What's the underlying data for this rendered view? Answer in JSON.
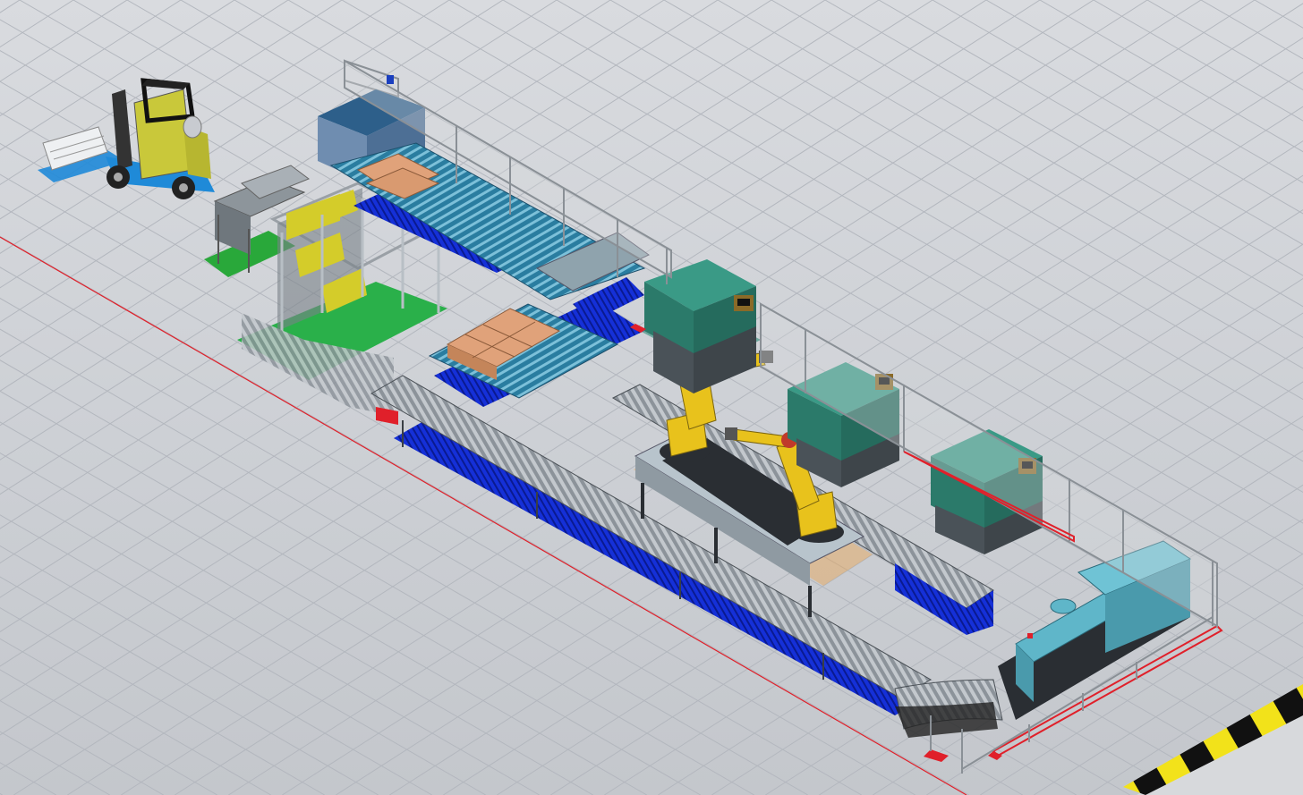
{
  "viewport": {
    "background": "#cdd0d5",
    "grid_color": "#b3b7be",
    "axis_color": "#e0202a"
  },
  "scene": {
    "objects": [
      {
        "name": "forklift",
        "kind": "vehicle",
        "color": "#c9c83a"
      },
      {
        "name": "pallet-feeder",
        "kind": "machine",
        "color": "#3d7f9a"
      },
      {
        "name": "pallet-dispenser",
        "kind": "machine",
        "color": "#2d5f8a"
      },
      {
        "name": "pallet-conveyor-upper",
        "kind": "conveyor",
        "color": "#3e8ca5"
      },
      {
        "name": "pallet-conveyor-lower",
        "kind": "conveyor",
        "color": "#3e8ca5"
      },
      {
        "name": "packaging-station",
        "kind": "machine",
        "color": "#d4cc2a"
      },
      {
        "name": "main-roller-conveyor",
        "kind": "conveyor",
        "color": "#9aa0a6"
      },
      {
        "name": "curved-conveyor",
        "kind": "conveyor",
        "color": "#9aa0a6"
      },
      {
        "name": "press-1",
        "kind": "press",
        "color": "#2f8a78"
      },
      {
        "name": "press-2",
        "kind": "press",
        "color": "#2f8a78"
      },
      {
        "name": "press-3",
        "kind": "press",
        "color": "#2f8a78"
      },
      {
        "name": "robot-1",
        "kind": "robot",
        "color": "#e8c21c"
      },
      {
        "name": "robot-2",
        "kind": "robot",
        "color": "#e8c21c"
      },
      {
        "name": "robot-table",
        "kind": "fixture",
        "color": "#b8c4cc"
      },
      {
        "name": "injection-molding-machine",
        "kind": "machine",
        "color": "#5fb6c9"
      },
      {
        "name": "safety-fence",
        "kind": "fence",
        "color": "#a9b0b6"
      },
      {
        "name": "floor-hazard-stripe",
        "kind": "marking",
        "color": "#f2e21a"
      }
    ]
  }
}
